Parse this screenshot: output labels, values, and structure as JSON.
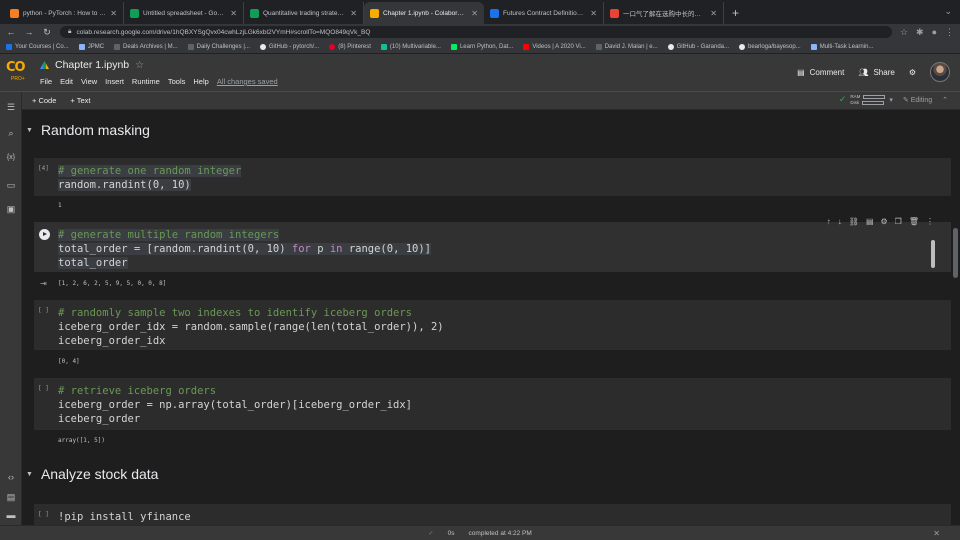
{
  "browser": {
    "tabs": [
      {
        "title": "python - PyTorch : How to print...",
        "color": "#f48024"
      },
      {
        "title": "Untitled spreadsheet - Google Sheets",
        "color": "#0f9d58"
      },
      {
        "title": "Quantitative trading strategies...",
        "color": "#0f9d58"
      },
      {
        "title": "Chapter 1.ipynb - Colaboratory",
        "color": "#f9ab00",
        "active": true
      },
      {
        "title": "Futures Contract Definition: Types",
        "color": "#1a73e8"
      },
      {
        "title": "一口气了解在选购中长的四专业十",
        "color": "#ea4335"
      }
    ],
    "new_tab": "+",
    "url": "colab.research.google.com/drive/1hQBXYSgQvx04cwhLzjLGk6xbl2VYmH#scrollTo=MQO849qVk_BQ",
    "bookmarks": [
      {
        "label": "Your Courses | Co...",
        "color": "#1a73e8"
      },
      {
        "label": "JPMC",
        "color": "#8ab4f8"
      },
      {
        "label": "Deals Archives | M...",
        "color": "#5f6368"
      },
      {
        "label": "Daily Challenges |...",
        "color": "#5f6368"
      },
      {
        "label": "GitHub - pytorch/...",
        "color": "#e8eaed"
      },
      {
        "label": "(8) Pinterest",
        "color": "#e60023"
      },
      {
        "label": "(10) Multivariable...",
        "color": "#14bf96"
      },
      {
        "label": "Learn Python, Dat...",
        "color": "#03ef62"
      },
      {
        "label": "Videos | A 2020 Vi...",
        "color": "#ff0000"
      },
      {
        "label": "David J. Malan | e...",
        "color": "#5f6368"
      },
      {
        "label": "GitHub - Garanda...",
        "color": "#e8eaed"
      },
      {
        "label": "bearloga/bayesop...",
        "color": "#e8eaed"
      },
      {
        "label": "Multi-Task Learnin...",
        "color": "#8ab4f8"
      }
    ]
  },
  "colab": {
    "logo": "CO",
    "logo_sub": "PRO+",
    "notebook_title": "Chapter 1.ipynb",
    "menu": [
      "File",
      "Edit",
      "View",
      "Insert",
      "Runtime",
      "Tools",
      "Help"
    ],
    "save_status": "All changes saved",
    "comment_label": "Comment",
    "share_label": "Share",
    "add_code": "+ Code",
    "add_text": "+ Text",
    "ram_label": "RAM",
    "disk_label": "Disk",
    "editing_label": "Editing"
  },
  "notebook": {
    "section1": "Random masking",
    "section2": "Analyze stock data",
    "cell1": {
      "exec": "[4]",
      "line1": "# generate one random integer",
      "line2": "random.randint(0, 10)",
      "output": "1"
    },
    "cell2": {
      "line1": "# generate multiple random integers",
      "line2a": "total_order = [random.randint(0, 10) ",
      "line2b": "for",
      "line2c": " p ",
      "line2d": "in",
      "line2e": " range(0, 10)]",
      "line3": "total_order",
      "output": "[1, 2, 6, 2, 5, 9, 5, 0, 0, 8]"
    },
    "cell3": {
      "exec": "[ ]",
      "line1": "# randomly sample two indexes to identify iceberg orders",
      "line2": "iceberg_order_idx = random.sample(range(len(total_order)), 2)",
      "line3": "iceberg_order_idx",
      "output": "[0, 4]"
    },
    "cell4": {
      "exec": "[ ]",
      "line1": "# retrieve iceberg orders",
      "line2": "iceberg_order = np.array(total_order)[iceberg_order_idx]",
      "line3": "iceberg_order",
      "output": "array([1, 5])"
    },
    "cell5": {
      "exec": "[ ]",
      "line1": "!pip install yfinance"
    }
  },
  "status": {
    "time": "0s",
    "message": "completed at 4:22 PM"
  }
}
